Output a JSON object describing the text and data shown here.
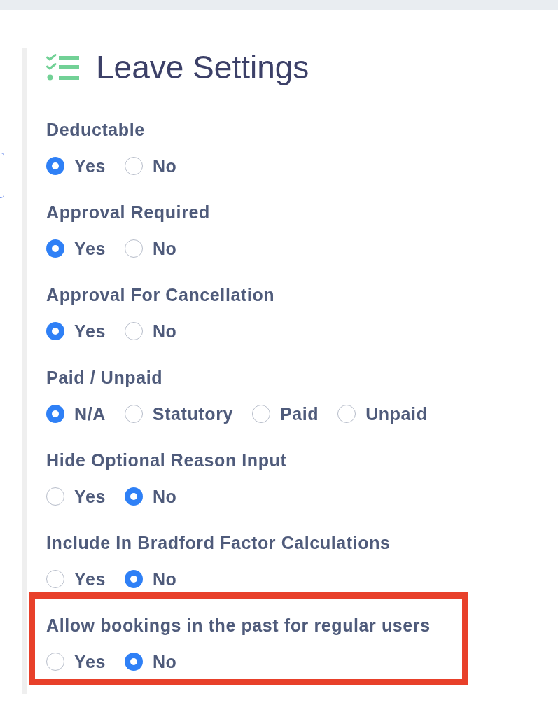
{
  "header": {
    "title": "Leave Settings"
  },
  "settings": [
    {
      "label": "Deductable",
      "highlighted": false,
      "options": [
        {
          "label": "Yes",
          "selected": true
        },
        {
          "label": "No",
          "selected": false
        }
      ]
    },
    {
      "label": "Approval Required",
      "highlighted": false,
      "options": [
        {
          "label": "Yes",
          "selected": true
        },
        {
          "label": "No",
          "selected": false
        }
      ]
    },
    {
      "label": "Approval For Cancellation",
      "highlighted": false,
      "options": [
        {
          "label": "Yes",
          "selected": true
        },
        {
          "label": "No",
          "selected": false
        }
      ]
    },
    {
      "label": "Paid / Unpaid",
      "highlighted": false,
      "options": [
        {
          "label": "N/A",
          "selected": true
        },
        {
          "label": "Statutory",
          "selected": false
        },
        {
          "label": "Paid",
          "selected": false
        },
        {
          "label": "Unpaid",
          "selected": false
        }
      ]
    },
    {
      "label": "Hide Optional Reason Input",
      "highlighted": false,
      "options": [
        {
          "label": "Yes",
          "selected": false
        },
        {
          "label": "No",
          "selected": true
        }
      ]
    },
    {
      "label": "Include In Bradford Factor Calculations",
      "highlighted": false,
      "options": [
        {
          "label": "Yes",
          "selected": false
        },
        {
          "label": "No",
          "selected": true
        }
      ]
    },
    {
      "label": "Allow bookings in the past for regular users",
      "highlighted": true,
      "options": [
        {
          "label": "Yes",
          "selected": false
        },
        {
          "label": "No",
          "selected": true
        }
      ]
    }
  ]
}
